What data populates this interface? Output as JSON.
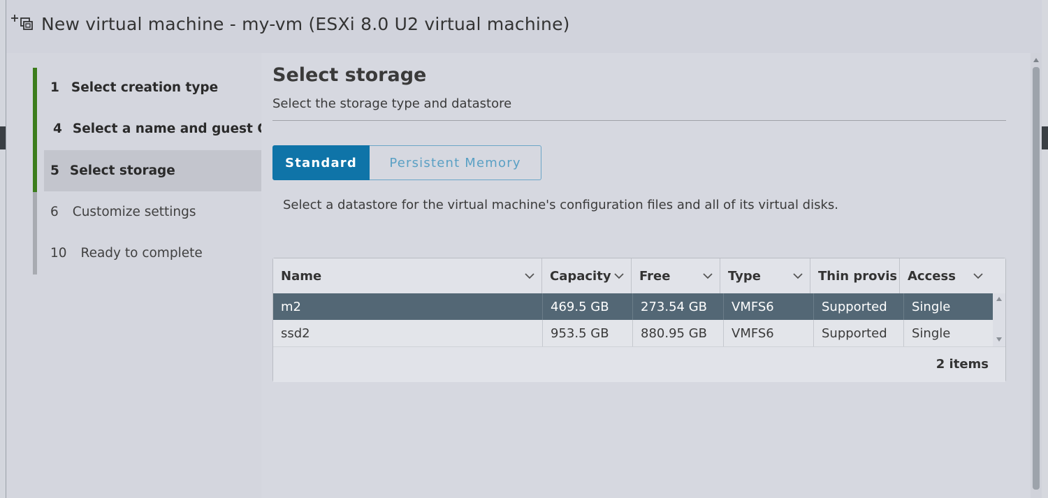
{
  "window": {
    "title": "New virtual machine - my-vm (ESXi 8.0 U2 virtual machine)"
  },
  "steps": [
    {
      "num": "1",
      "label": "Select creation type",
      "state": "done"
    },
    {
      "num": "4",
      "label": "Select a name and guest OS",
      "state": "done"
    },
    {
      "num": "5",
      "label": "Select storage",
      "state": "active"
    },
    {
      "num": "6",
      "label": "Customize settings",
      "state": "todo"
    },
    {
      "num": "10",
      "label": "Ready to complete",
      "state": "todo"
    }
  ],
  "page": {
    "title": "Select storage",
    "subtitle": "Select the storage type and datastore",
    "instruction": "Select a datastore for the virtual machine's configuration files and all of its virtual disks."
  },
  "storage_type": {
    "standard_label": "Standard",
    "persistent_label": "Persistent Memory",
    "selected": "Standard"
  },
  "grid": {
    "columns": [
      "Name",
      "Capacity",
      "Free",
      "Type",
      "Thin provisioning",
      "Access"
    ],
    "rows": [
      {
        "name": "m2",
        "capacity": "469.5 GB",
        "free": "273.54 GB",
        "type": "VMFS6",
        "thin": "Supported",
        "access": "Single",
        "selected": true
      },
      {
        "name": "ssd2",
        "capacity": "953.5 GB",
        "free": "880.95 GB",
        "type": "VMFS6",
        "thin": "Supported",
        "access": "Single",
        "selected": false
      }
    ],
    "footer": "2 items"
  },
  "colors": {
    "accent": "#0f74a8",
    "done_bar": "#3c7d1c",
    "todo_bar": "#a8abb1",
    "selected_row": "#536775"
  },
  "icons": {
    "header": "new-vm-icon",
    "sort": "chevron-down-icon"
  }
}
